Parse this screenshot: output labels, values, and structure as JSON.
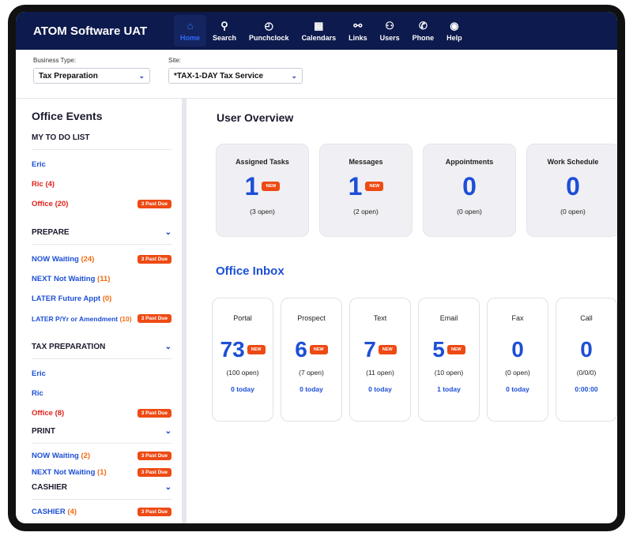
{
  "app": {
    "title": "ATOM Software UAT"
  },
  "nav": [
    {
      "label": "Home",
      "icon": "home-icon",
      "glyph": "⌂"
    },
    {
      "label": "Search",
      "icon": "search-icon",
      "glyph": "⚲"
    },
    {
      "label": "Punchclock",
      "icon": "clock-icon",
      "glyph": "◴"
    },
    {
      "label": "Calendars",
      "icon": "calendar-icon",
      "glyph": "▦"
    },
    {
      "label": "Links",
      "icon": "link-icon",
      "glyph": "⚯"
    },
    {
      "label": "Users",
      "icon": "users-icon",
      "glyph": "⚇"
    },
    {
      "label": "Phone",
      "icon": "phone-icon",
      "glyph": "✆"
    },
    {
      "label": "Help",
      "icon": "help-icon",
      "glyph": "◉"
    }
  ],
  "filters": {
    "business_type": {
      "label": "Business Type:",
      "value": "Tax Preparation"
    },
    "site": {
      "label": "Site:",
      "value": "*TAX-1-DAY Tax Service"
    }
  },
  "sidebar": {
    "title": "Office Events",
    "past_due_label": "3 Past Due",
    "todo": {
      "heading": "MY TO DO LIST",
      "items": [
        {
          "label": "Eric",
          "count": ""
        },
        {
          "label": "Ric",
          "count": "(4)"
        },
        {
          "label": "Office",
          "count": "(20)"
        }
      ]
    },
    "prepare": {
      "heading": "PREPARE",
      "items": [
        {
          "label": "NOW Waiting",
          "count": "(24)"
        },
        {
          "label": "NEXT Not Waiting",
          "count": "(11)"
        },
        {
          "label": "LATER Future Appt",
          "count": "(0)"
        },
        {
          "label": "LATER P/Yr or Amendment",
          "count": "(10)"
        }
      ]
    },
    "tax_preparation": {
      "heading": "TAX PREPARATION",
      "items": [
        {
          "label": "Eric",
          "count": ""
        },
        {
          "label": "Ric",
          "count": ""
        },
        {
          "label": "Office",
          "count": "(8)"
        }
      ]
    },
    "print": {
      "heading": "PRINT",
      "items": [
        {
          "label": "NOW Waiting",
          "count": "(2)"
        },
        {
          "label": "NEXT Not Waiting",
          "count": "(1)"
        }
      ]
    },
    "cashier": {
      "heading": "CASHIER",
      "items": [
        {
          "label": "CASHIER",
          "count": "(4)"
        }
      ]
    }
  },
  "overview": {
    "title": "User Overview",
    "new_label": "NEW",
    "cards": [
      {
        "title": "Assigned Tasks",
        "value": "1",
        "sub": "(3 open)"
      },
      {
        "title": "Messages",
        "value": "1",
        "sub": "(2 open)"
      },
      {
        "title": "Appointments",
        "value": "0",
        "sub": "(0 open)"
      },
      {
        "title": "Work Schedule",
        "value": "0",
        "sub": "(0 open)"
      }
    ]
  },
  "inbox": {
    "title": "Office Inbox",
    "cards": [
      {
        "title": "Portal",
        "value": "73",
        "sub": "(100 open)",
        "today": "0 today"
      },
      {
        "title": "Prospect",
        "value": "6",
        "sub": "(7 open)",
        "today": "0 today"
      },
      {
        "title": "Text",
        "value": "7",
        "sub": "(11 open)",
        "today": "0 today"
      },
      {
        "title": "Email",
        "value": "5",
        "sub": "(10 open)",
        "today": "1 today"
      },
      {
        "title": "Fax",
        "value": "0",
        "sub": "(0 open)",
        "today": "0 today"
      },
      {
        "title": "Call",
        "value": "0",
        "sub": "(0/0/0)",
        "today": "0:00:00"
      }
    ]
  },
  "colors": {
    "nav_bg": "#0d1a4d",
    "accent_blue": "#1d4fd6",
    "alert_orange": "#ee4a14",
    "alert_red": "#e0211b"
  }
}
